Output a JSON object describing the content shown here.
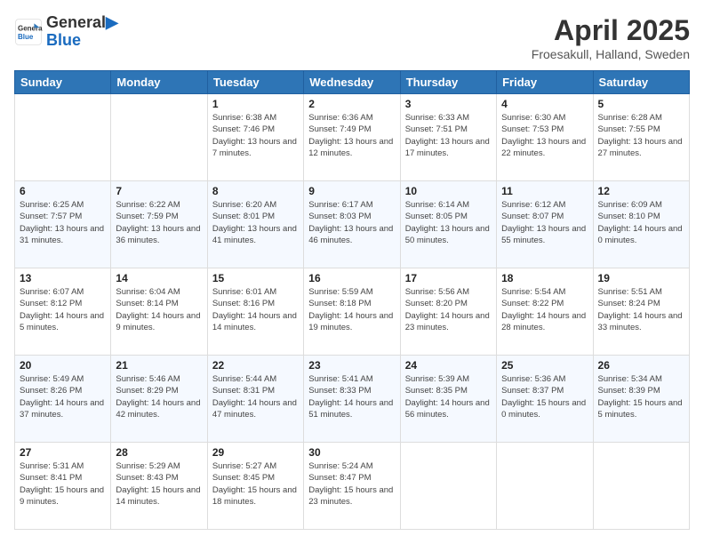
{
  "header": {
    "logo_line1": "General",
    "logo_line2": "Blue",
    "month_title": "April 2025",
    "subtitle": "Froesakull, Halland, Sweden"
  },
  "days_of_week": [
    "Sunday",
    "Monday",
    "Tuesday",
    "Wednesday",
    "Thursday",
    "Friday",
    "Saturday"
  ],
  "weeks": [
    [
      {
        "day": "",
        "info": ""
      },
      {
        "day": "",
        "info": ""
      },
      {
        "day": "1",
        "info": "Sunrise: 6:38 AM\nSunset: 7:46 PM\nDaylight: 13 hours and 7 minutes."
      },
      {
        "day": "2",
        "info": "Sunrise: 6:36 AM\nSunset: 7:49 PM\nDaylight: 13 hours and 12 minutes."
      },
      {
        "day": "3",
        "info": "Sunrise: 6:33 AM\nSunset: 7:51 PM\nDaylight: 13 hours and 17 minutes."
      },
      {
        "day": "4",
        "info": "Sunrise: 6:30 AM\nSunset: 7:53 PM\nDaylight: 13 hours and 22 minutes."
      },
      {
        "day": "5",
        "info": "Sunrise: 6:28 AM\nSunset: 7:55 PM\nDaylight: 13 hours and 27 minutes."
      }
    ],
    [
      {
        "day": "6",
        "info": "Sunrise: 6:25 AM\nSunset: 7:57 PM\nDaylight: 13 hours and 31 minutes."
      },
      {
        "day": "7",
        "info": "Sunrise: 6:22 AM\nSunset: 7:59 PM\nDaylight: 13 hours and 36 minutes."
      },
      {
        "day": "8",
        "info": "Sunrise: 6:20 AM\nSunset: 8:01 PM\nDaylight: 13 hours and 41 minutes."
      },
      {
        "day": "9",
        "info": "Sunrise: 6:17 AM\nSunset: 8:03 PM\nDaylight: 13 hours and 46 minutes."
      },
      {
        "day": "10",
        "info": "Sunrise: 6:14 AM\nSunset: 8:05 PM\nDaylight: 13 hours and 50 minutes."
      },
      {
        "day": "11",
        "info": "Sunrise: 6:12 AM\nSunset: 8:07 PM\nDaylight: 13 hours and 55 minutes."
      },
      {
        "day": "12",
        "info": "Sunrise: 6:09 AM\nSunset: 8:10 PM\nDaylight: 14 hours and 0 minutes."
      }
    ],
    [
      {
        "day": "13",
        "info": "Sunrise: 6:07 AM\nSunset: 8:12 PM\nDaylight: 14 hours and 5 minutes."
      },
      {
        "day": "14",
        "info": "Sunrise: 6:04 AM\nSunset: 8:14 PM\nDaylight: 14 hours and 9 minutes."
      },
      {
        "day": "15",
        "info": "Sunrise: 6:01 AM\nSunset: 8:16 PM\nDaylight: 14 hours and 14 minutes."
      },
      {
        "day": "16",
        "info": "Sunrise: 5:59 AM\nSunset: 8:18 PM\nDaylight: 14 hours and 19 minutes."
      },
      {
        "day": "17",
        "info": "Sunrise: 5:56 AM\nSunset: 8:20 PM\nDaylight: 14 hours and 23 minutes."
      },
      {
        "day": "18",
        "info": "Sunrise: 5:54 AM\nSunset: 8:22 PM\nDaylight: 14 hours and 28 minutes."
      },
      {
        "day": "19",
        "info": "Sunrise: 5:51 AM\nSunset: 8:24 PM\nDaylight: 14 hours and 33 minutes."
      }
    ],
    [
      {
        "day": "20",
        "info": "Sunrise: 5:49 AM\nSunset: 8:26 PM\nDaylight: 14 hours and 37 minutes."
      },
      {
        "day": "21",
        "info": "Sunrise: 5:46 AM\nSunset: 8:29 PM\nDaylight: 14 hours and 42 minutes."
      },
      {
        "day": "22",
        "info": "Sunrise: 5:44 AM\nSunset: 8:31 PM\nDaylight: 14 hours and 47 minutes."
      },
      {
        "day": "23",
        "info": "Sunrise: 5:41 AM\nSunset: 8:33 PM\nDaylight: 14 hours and 51 minutes."
      },
      {
        "day": "24",
        "info": "Sunrise: 5:39 AM\nSunset: 8:35 PM\nDaylight: 14 hours and 56 minutes."
      },
      {
        "day": "25",
        "info": "Sunrise: 5:36 AM\nSunset: 8:37 PM\nDaylight: 15 hours and 0 minutes."
      },
      {
        "day": "26",
        "info": "Sunrise: 5:34 AM\nSunset: 8:39 PM\nDaylight: 15 hours and 5 minutes."
      }
    ],
    [
      {
        "day": "27",
        "info": "Sunrise: 5:31 AM\nSunset: 8:41 PM\nDaylight: 15 hours and 9 minutes."
      },
      {
        "day": "28",
        "info": "Sunrise: 5:29 AM\nSunset: 8:43 PM\nDaylight: 15 hours and 14 minutes."
      },
      {
        "day": "29",
        "info": "Sunrise: 5:27 AM\nSunset: 8:45 PM\nDaylight: 15 hours and 18 minutes."
      },
      {
        "day": "30",
        "info": "Sunrise: 5:24 AM\nSunset: 8:47 PM\nDaylight: 15 hours and 23 minutes."
      },
      {
        "day": "",
        "info": ""
      },
      {
        "day": "",
        "info": ""
      },
      {
        "day": "",
        "info": ""
      }
    ]
  ]
}
